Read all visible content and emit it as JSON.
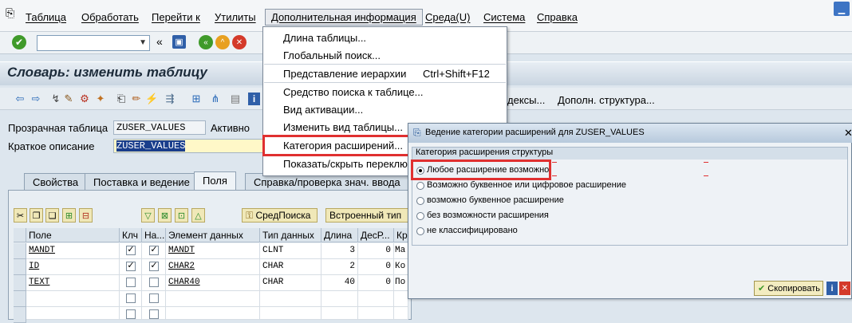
{
  "menubar": {
    "items": [
      "Таблица",
      "Обработать",
      "Перейти к",
      "Утилиты",
      "Дополнительная информация",
      "Среда(U)",
      "Система",
      "Справка"
    ]
  },
  "header": {
    "title": "Словарь: изменить таблицу"
  },
  "toolbar2": {
    "extra_labels": [
      "дексы...",
      "Дополн. структура..."
    ]
  },
  "form": {
    "table_label": "Прозрачная таблица",
    "table_value": "ZUSER_VALUES",
    "status": "Активно",
    "desc_label": "Краткое описание",
    "desc_value": "ZUSER_VALUES"
  },
  "tabs": [
    "Свойства",
    "Поставка и ведение",
    "Поля",
    "Справка/проверка знач. ввода"
  ],
  "grid": {
    "buttons": [
      "СредПоиска",
      "Встроенный тип"
    ],
    "columns": [
      "Поле",
      "Клч",
      "На...",
      "Элемент данных",
      "Тип данных",
      "Длина",
      "ДесР...",
      "Кр"
    ],
    "rows": [
      {
        "field": "MANDT",
        "key": true,
        "init": true,
        "element": "MANDT",
        "type": "CLNT",
        "length": "3",
        "dec": "0",
        "short": "Ма"
      },
      {
        "field": "ID",
        "key": true,
        "init": true,
        "element": "CHAR2",
        "type": "CHAR",
        "length": "2",
        "dec": "0",
        "short": "Ко"
      },
      {
        "field": "TEXT",
        "key": false,
        "init": false,
        "element": "CHAR40",
        "type": "CHAR",
        "length": "40",
        "dec": "0",
        "short": "По"
      }
    ]
  },
  "menu": {
    "items": [
      "Длина таблицы...",
      "Глобальный поиск...",
      "Представление иерархии",
      "Средство поиска к таблице...",
      "Вид активации...",
      "Изменить вид таблицы...",
      "Категория расширений...",
      "Показать/скрыть переключ"
    ],
    "shortcut": "Ctrl+Shift+F12"
  },
  "dialog": {
    "title": "Ведение категории расширений для ZUSER_VALUES",
    "group_title": "Категория расширения структуры",
    "options": [
      "Любое расширение возможно",
      "Возможно буквенное или цифровое расширение",
      "возможно буквенное расширение",
      "без возможности расширения",
      "не классифицировано"
    ],
    "selected": 0,
    "copy_button": "Скопировать"
  },
  "colors": {
    "highlight_red": "#e03030",
    "title_text": "#1c2b3a"
  }
}
